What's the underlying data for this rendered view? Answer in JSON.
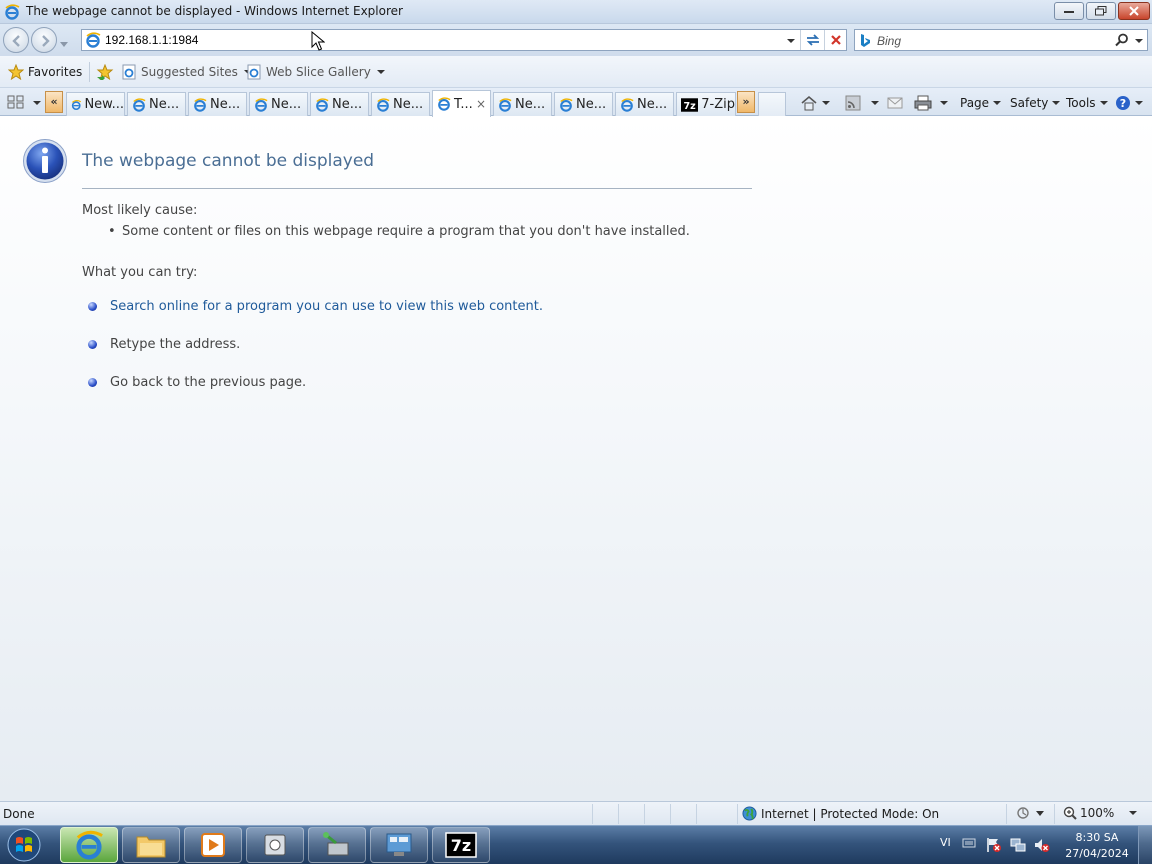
{
  "window": {
    "title": "The webpage cannot be displayed - Windows Internet Explorer"
  },
  "nav": {
    "address": "192.168.1.1:1984",
    "search_placeholder": "Bing"
  },
  "favorites_bar": {
    "favorites_label": "Favorites",
    "items": [
      "Suggested Sites",
      "Web Slice Gallery"
    ]
  },
  "tabs": [
    {
      "label": "New...",
      "active": false
    },
    {
      "label": "Ne...",
      "active": false
    },
    {
      "label": "Ne...",
      "active": false
    },
    {
      "label": "Ne...",
      "active": false
    },
    {
      "label": "Ne...",
      "active": false
    },
    {
      "label": "Ne...",
      "active": false
    },
    {
      "label": "T...",
      "active": true
    },
    {
      "label": "Ne...",
      "active": false
    },
    {
      "label": "Ne...",
      "active": false
    },
    {
      "label": "Ne...",
      "active": false
    },
    {
      "label": "7-Zip",
      "active": false
    }
  ],
  "tab_close_glyph": "×",
  "scroll_left": "«",
  "scroll_right": "»",
  "commands": {
    "page": "Page",
    "safety": "Safety",
    "tools": "Tools"
  },
  "content": {
    "title": "The webpage cannot be displayed",
    "cause_label": "Most likely cause:",
    "cause_items": [
      "Some content or files on this webpage require a program that you don't have installed."
    ],
    "try_label": "What you can try:",
    "try_items": [
      "Search online for a program you can use to view this web content.",
      "Retype the address.",
      "Go back to the previous page."
    ]
  },
  "status": {
    "text": "Done",
    "zone": "Internet | Protected Mode: On",
    "zoom": "100%"
  },
  "taskbar": {
    "language": "VI",
    "time": "8:30 SA",
    "date": "27/04/2024"
  },
  "colors": {
    "title_blue": "#4a6e94",
    "link_blue": "#1f5a9a"
  }
}
